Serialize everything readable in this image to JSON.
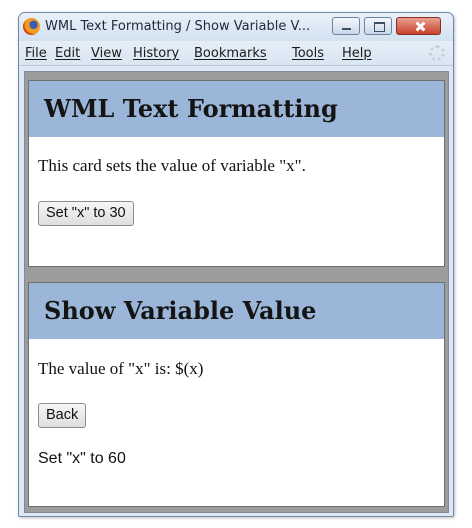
{
  "window": {
    "title": "WML Text Formatting / Show Variable V...",
    "app_icon": "firefox-icon",
    "controls": [
      "minimize-icon",
      "maximize-icon",
      "close-icon"
    ]
  },
  "menubar": {
    "items": [
      {
        "label": "File"
      },
      {
        "label": "Edit"
      },
      {
        "label": "View"
      },
      {
        "label": "History"
      },
      {
        "label": "Bookmarks"
      },
      {
        "label": "Tools"
      },
      {
        "label": "Help"
      }
    ],
    "status_icon": "throbber-icon"
  },
  "cards": [
    {
      "title": "WML Text Formatting",
      "text": "This card sets the value of variable \"x\".",
      "button_label": "Set \"x\" to 30"
    },
    {
      "title": "Show Variable Value",
      "text": "The value of \"x\" is: $(x)",
      "button_label": "Back",
      "footer_text": "Set \"x\" to 60"
    }
  ],
  "colors": {
    "card_header": "#9bb6d8",
    "deck_background": "#9c9c9c",
    "window_chrome": "#dde8f4"
  }
}
